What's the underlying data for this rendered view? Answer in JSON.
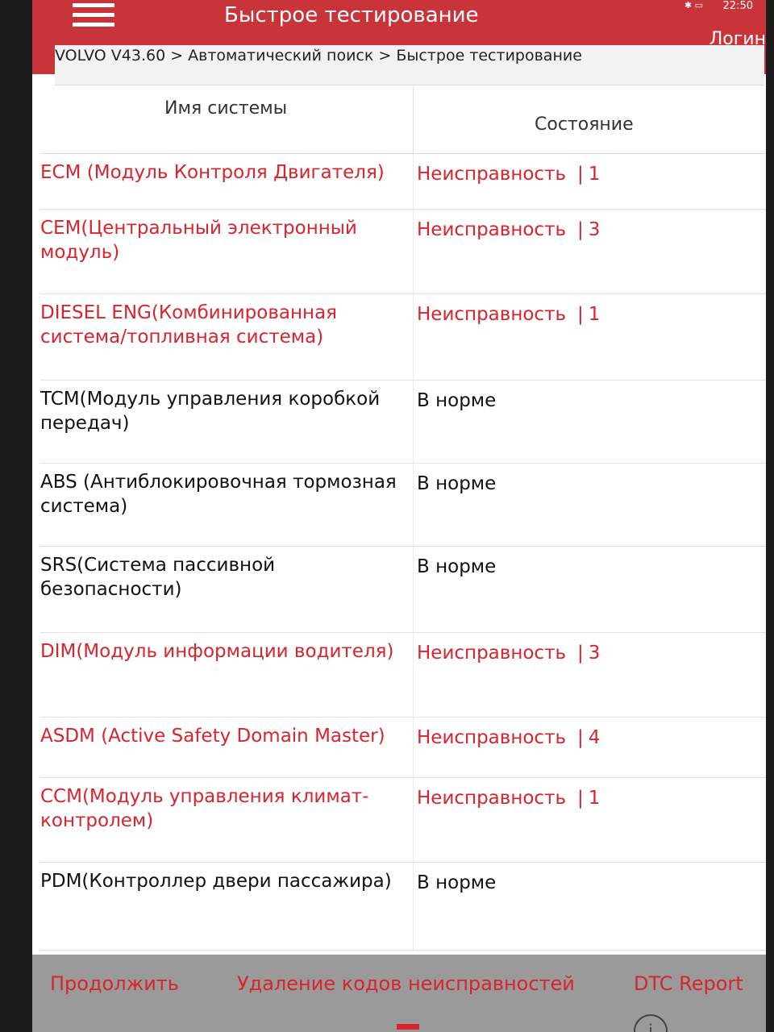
{
  "header": {
    "title": "Быстрое тестирование",
    "login_label": "Логин",
    "time": "22:50",
    "status_icons": "✱ ▭"
  },
  "breadcrumb": "VOLVO V43.60 > Автоматический поиск > Быстрое тестирование",
  "table": {
    "col_name": "Имя системы",
    "col_status": "Состояние",
    "rows": [
      {
        "name": "ECM (Модуль Контроля Двигателя)",
        "status": "Неисправность",
        "count": "1",
        "fault": true
      },
      {
        "name": "CEM(Центральный электронный модуль)",
        "status": "Неисправность",
        "count": "3",
        "fault": true
      },
      {
        "name": "DIESEL ENG(Комбинированная система/топливная система)",
        "status": "Неисправность",
        "count": "1",
        "fault": true
      },
      {
        "name": "TCM(Модуль управления коробкой передач)",
        "status": "В норме",
        "count": "",
        "fault": false
      },
      {
        "name": "ABS (Антиблокировочная тормозная система)",
        "status": "В норме",
        "count": "",
        "fault": false
      },
      {
        "name": "SRS(Система пассивной безопасности)",
        "status": "В норме",
        "count": "",
        "fault": false
      },
      {
        "name": "DIM(Модуль информации водителя)",
        "status": "Неисправность",
        "count": "3",
        "fault": true
      },
      {
        "name": "ASDM (Active Safety Domain Master)",
        "status": "Неисправность",
        "count": "4",
        "fault": true
      },
      {
        "name": "CCM(Модуль управления климат-контролем)",
        "status": "Неисправность",
        "count": "1",
        "fault": true
      },
      {
        "name": "PDM(Контроллер двери пассажира)",
        "status": "В норме",
        "count": "",
        "fault": false
      }
    ]
  },
  "footer": {
    "continue_label": "Продолжить",
    "clear_label": "Удаление кодов неисправностей",
    "dtc_label": "DTC Report",
    "info_glyph": "i"
  },
  "colors": {
    "header_bg": "#c9343a",
    "fault_text": "#d8242c"
  }
}
